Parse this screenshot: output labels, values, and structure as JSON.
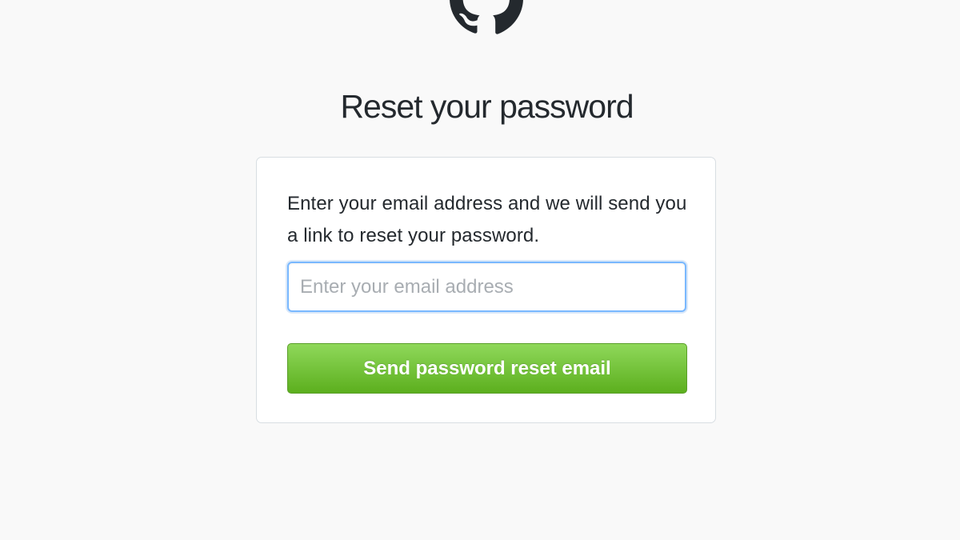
{
  "header": {
    "logo_icon": "github-octocat-icon",
    "title": "Reset your password"
  },
  "form": {
    "instructions": "Enter your email address and we will send you a link to reset your password.",
    "email": {
      "value": "",
      "placeholder": "Enter your email address"
    },
    "submit_label": "Send password reset email"
  },
  "colors": {
    "background": "#f9f9f9",
    "card": "#ffffff",
    "button_green_top": "#8fd85a",
    "button_green_bottom": "#5caf1e",
    "input_focus_border": "#79b8ff",
    "text": "#24292e"
  }
}
